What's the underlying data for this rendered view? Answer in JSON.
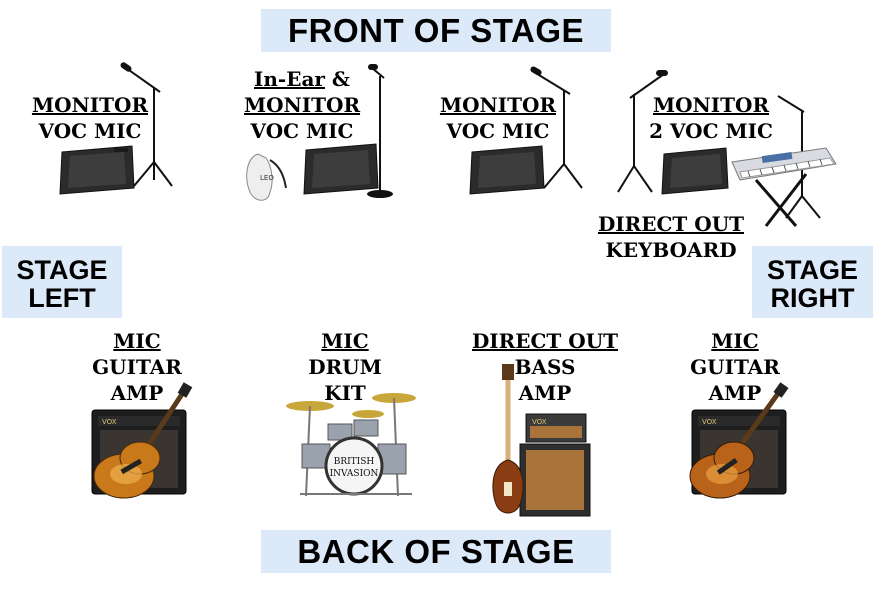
{
  "stage": {
    "front": "FRONT OF STAGE",
    "back": "BACK OF STAGE",
    "left": [
      "STAGE",
      "LEFT"
    ],
    "right": [
      "STAGE",
      "RIGHT"
    ]
  },
  "positions": {
    "front1": [
      "MONITOR",
      "VOC MIC"
    ],
    "front2": {
      "line1a": "In-Ear",
      "line1b": " &",
      "line2": "MONITOR",
      "line3": "VOC MIC"
    },
    "front3": [
      "MONITOR",
      "VOC MIC"
    ],
    "front4": [
      "MONITOR",
      "2 VOC MIC"
    ],
    "keyboard": [
      "DIRECT OUT",
      "KEYBOARD"
    ],
    "back1": [
      "MIC",
      "GUITAR",
      "AMP"
    ],
    "back2": [
      "MIC",
      "DRUM",
      "KIT"
    ],
    "back3": [
      "DIRECT OUT",
      "BASS",
      "AMP"
    ],
    "back4": [
      "MIC",
      "GUITAR",
      "AMP"
    ]
  },
  "logos": {
    "inear": "LEO",
    "amp": "VOX",
    "drum": [
      "BRITISH",
      "INVASION"
    ]
  },
  "colors": {
    "band": "#dce9f9",
    "monitor": "#2b2b2b",
    "amp_grille": "#3a3530",
    "guitar_sunburst": "#c9781a",
    "bass_body": "#8a3d12",
    "cab_grille": "#a8743a"
  }
}
